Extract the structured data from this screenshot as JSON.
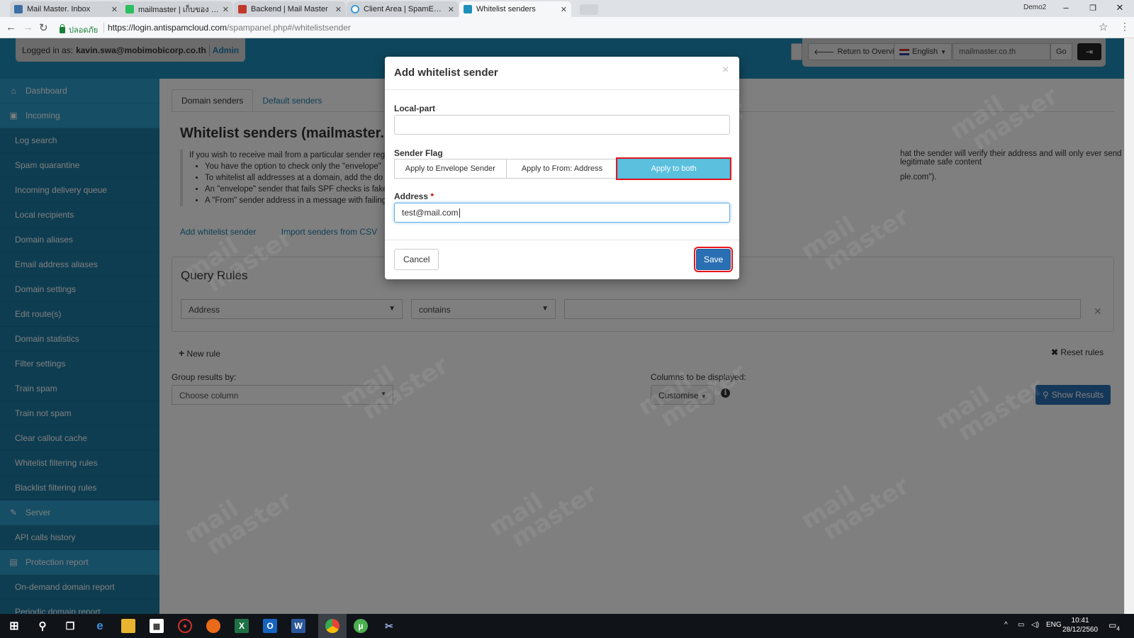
{
  "browser": {
    "tabs": [
      {
        "label": "Mail Master. Inbox",
        "color": "#3b6ea5",
        "active": false
      },
      {
        "label": "mailmaster | เก็บของ Evern",
        "color": "#2dbe60",
        "active": false
      },
      {
        "label": "Backend | Mail Master",
        "color": "#c0392b",
        "active": false
      },
      {
        "label": "Client Area | SpamExpert",
        "color": "#3a9bd5",
        "active": false
      },
      {
        "label": "Whitelist senders",
        "color": "#1d8fbb",
        "active": true
      }
    ],
    "user": "Demo2",
    "secure_label": "ปลอดภัย",
    "url_host": "https://login.antispamcloud.com",
    "url_path": "/spampanel.php#/whitelistsender"
  },
  "header": {
    "logged_in_label": "Logged in as:",
    "user_email": "kavin.swa@mobimobicorp.co.th",
    "role": "Admin",
    "return_label": "Return to Overview",
    "language": "English",
    "domain_value": "mailmaster.co.th",
    "go_label": "Go"
  },
  "sidebar": {
    "items": [
      {
        "label": "Dashboard",
        "type": "sect",
        "icon": "home-icon",
        "glyph": "⌂"
      },
      {
        "label": "Incoming",
        "type": "sect",
        "icon": "inbox-icon",
        "glyph": "▣"
      },
      {
        "label": "Log search",
        "type": "sub"
      },
      {
        "label": "Spam quarantine",
        "type": "sub"
      },
      {
        "label": "Incoming delivery queue",
        "type": "sub"
      },
      {
        "label": "Local recipients",
        "type": "sub"
      },
      {
        "label": "Domain aliases",
        "type": "sub"
      },
      {
        "label": "Email address aliases",
        "type": "sub"
      },
      {
        "label": "Domain settings",
        "type": "sub"
      },
      {
        "label": "Edit route(s)",
        "type": "sub"
      },
      {
        "label": "Domain statistics",
        "type": "sub"
      },
      {
        "label": "Filter settings",
        "type": "sub"
      },
      {
        "label": "Train spam",
        "type": "sub"
      },
      {
        "label": "Train not spam",
        "type": "sub"
      },
      {
        "label": "Clear callout cache",
        "type": "sub"
      },
      {
        "label": "Whitelist filtering rules",
        "type": "sub"
      },
      {
        "label": "Blacklist filtering rules",
        "type": "sub"
      },
      {
        "label": "Server",
        "type": "sect",
        "icon": "wrench-icon",
        "glyph": "✎"
      },
      {
        "label": "API calls history",
        "type": "sub"
      },
      {
        "label": "Protection report",
        "type": "sect",
        "icon": "document-icon",
        "glyph": "▤"
      },
      {
        "label": "On-demand domain report",
        "type": "sub"
      },
      {
        "label": "Periodic domain report",
        "type": "sub"
      }
    ]
  },
  "main": {
    "tabs": [
      "Domain senders",
      "Default senders"
    ],
    "title": "Whitelist senders (mailmaster.",
    "info_lead": "If you wish to receive mail from a particular sender reg",
    "info_bullets": [
      "You have the option to check only the \"envelope\"",
      "To whitelist all addresses at a domain, add the do",
      "An \"envelope\" sender that fails SPF checks is fake",
      "A \"From\" sender address in a message with failing"
    ],
    "info_right_1": "hat the sender will verify their address and will only ever send legitimate safe content",
    "info_right_2": "ple.com\").",
    "add_link": "Add whitelist sender",
    "import_link": "Import senders from CSV",
    "query_title": "Query Rules",
    "field_select": "Address",
    "op_select": "contains",
    "new_rule": "New rule",
    "reset_rules": "Reset rules",
    "group_label": "Group results by:",
    "group_placeholder": "Choose column",
    "columns_label": "Columns to be displayed:",
    "customise": "Customise",
    "show_results": "Show Results"
  },
  "modal": {
    "title": "Add whitelist sender",
    "localpart_label": "Local-part",
    "localpart_value": "",
    "flag_label": "Sender Flag",
    "flag_options": [
      "Apply to Envelope Sender",
      "Apply to From: Address",
      "Apply to both"
    ],
    "flag_selected": 2,
    "address_label": "Address",
    "address_required": "*",
    "address_value": "test@mail.com",
    "cancel": "Cancel",
    "save": "Save"
  },
  "watermark": {
    "line1": "mail",
    "line2": "master"
  },
  "taskbar": {
    "lang": "ENG",
    "time": "10:41",
    "date": "28/12/2560",
    "notif_count": "4"
  }
}
